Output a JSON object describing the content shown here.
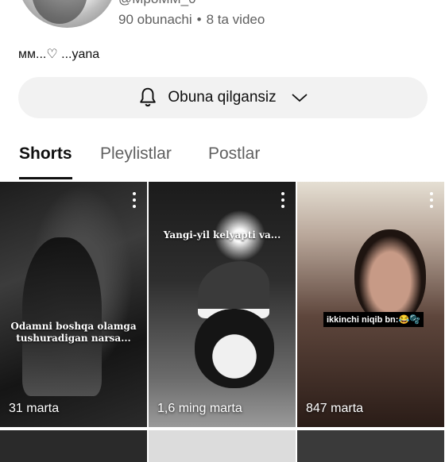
{
  "channel": {
    "handle": "@MpoMM_0",
    "subscribers": "90 obunachi",
    "separator": "•",
    "video_count": "8 ta video",
    "description": "мм...♡ ...yana"
  },
  "subscribe_button": {
    "label": "Obuna qilgansiz",
    "icon": "bell-icon",
    "dropdown_icon": "chevron-down-icon"
  },
  "tabs": [
    {
      "label": "Shorts",
      "active": true
    },
    {
      "label": "Pleylistlar",
      "active": false
    },
    {
      "label": "Postlar",
      "active": false
    }
  ],
  "shorts": [
    {
      "caption": "Odamni boshqa olamga tushuradigan narsa...",
      "views": "31 marta"
    },
    {
      "caption": "Yangi-yil kelyapti va...",
      "views": "1,6 ming marta"
    },
    {
      "caption": "ikkinchi niqib bn:😂🫧",
      "views": "847 marta"
    }
  ],
  "colors": {
    "text_primary": "#0f0f0f",
    "text_secondary": "#606060",
    "button_bg": "#f2f2f2"
  }
}
